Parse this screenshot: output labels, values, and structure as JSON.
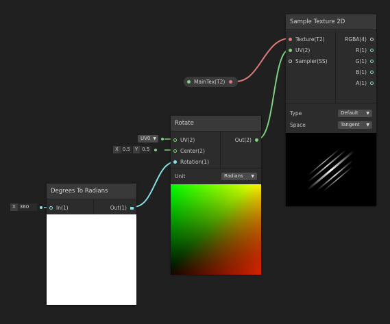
{
  "sample_texture": {
    "title": "Sample Texture 2D",
    "inputs": [
      "Texture(T2)",
      "UV(2)",
      "Sampler(SS)"
    ],
    "outputs": [
      "RGBA(4)",
      "R(1)",
      "G(1)",
      "B(1)",
      "A(1)"
    ],
    "type_label": "Type",
    "type_value": "Default",
    "space_label": "Space",
    "space_value": "Tangent"
  },
  "maintex": {
    "label": "MainTex(T2)"
  },
  "rotate": {
    "title": "Rotate",
    "inputs": [
      "UV(2)",
      "Center(2)",
      "Rotation(1)"
    ],
    "output": "Out(2)",
    "unit_label": "Unit",
    "unit_value": "Radians",
    "uv_default": "UV0",
    "center_x_label": "X",
    "center_x": "0.5",
    "center_y_label": "Y",
    "center_y": "0.5"
  },
  "deg2rad": {
    "title": "Degrees To Radians",
    "input": "In(1)",
    "output": "Out(1)",
    "x_label": "X",
    "x_value": "360"
  },
  "colors": {
    "background": "#202020",
    "texture_wire": "#e07a7a",
    "vector2_wire": "#7fd17f",
    "float_wire": "#84e4e7"
  }
}
